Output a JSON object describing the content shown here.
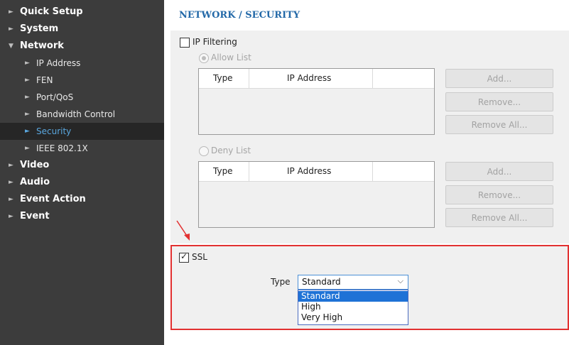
{
  "sidebar": {
    "items": [
      {
        "label": "Quick Setup",
        "arrow": "►"
      },
      {
        "label": "System",
        "arrow": "►"
      },
      {
        "label": "Network",
        "arrow": "▼"
      },
      {
        "label": "Video",
        "arrow": "►"
      },
      {
        "label": "Audio",
        "arrow": "►"
      },
      {
        "label": "Event Action",
        "arrow": "►"
      },
      {
        "label": "Event",
        "arrow": "►"
      }
    ],
    "network_sub": [
      {
        "label": "IP Address",
        "arrow": "►"
      },
      {
        "label": "FEN",
        "arrow": "►"
      },
      {
        "label": "Port/QoS",
        "arrow": "►"
      },
      {
        "label": "Bandwidth Control",
        "arrow": "►"
      },
      {
        "label": "Security",
        "arrow": "►",
        "active": true
      },
      {
        "label": "IEEE 802.1X",
        "arrow": "►"
      }
    ]
  },
  "page": {
    "title": "NETWORK / SECURITY"
  },
  "ip_filtering": {
    "label": "IP Filtering",
    "checked": false,
    "allow_list": {
      "label": "Allow List",
      "columns": [
        "Type",
        "IP Address"
      ],
      "buttons": {
        "add": "Add...",
        "remove": "Remove...",
        "remove_all": "Remove All..."
      }
    },
    "deny_list": {
      "label": "Deny List",
      "columns": [
        "Type",
        "IP Address"
      ],
      "buttons": {
        "add": "Add...",
        "remove": "Remove...",
        "remove_all": "Remove All..."
      }
    }
  },
  "ssl": {
    "label": "SSL",
    "checked": true,
    "checkmark": "✓",
    "type_label": "Type",
    "selected": "Standard",
    "chevron": "⌵",
    "options": [
      "Standard",
      "High",
      "Very High"
    ]
  },
  "colors": {
    "sidebar_bg": "#3c3c3c",
    "title": "#2369a8",
    "highlight_border": "#e23131",
    "active_nav": "#5aa7df",
    "option_selected": "#1e72d6"
  }
}
